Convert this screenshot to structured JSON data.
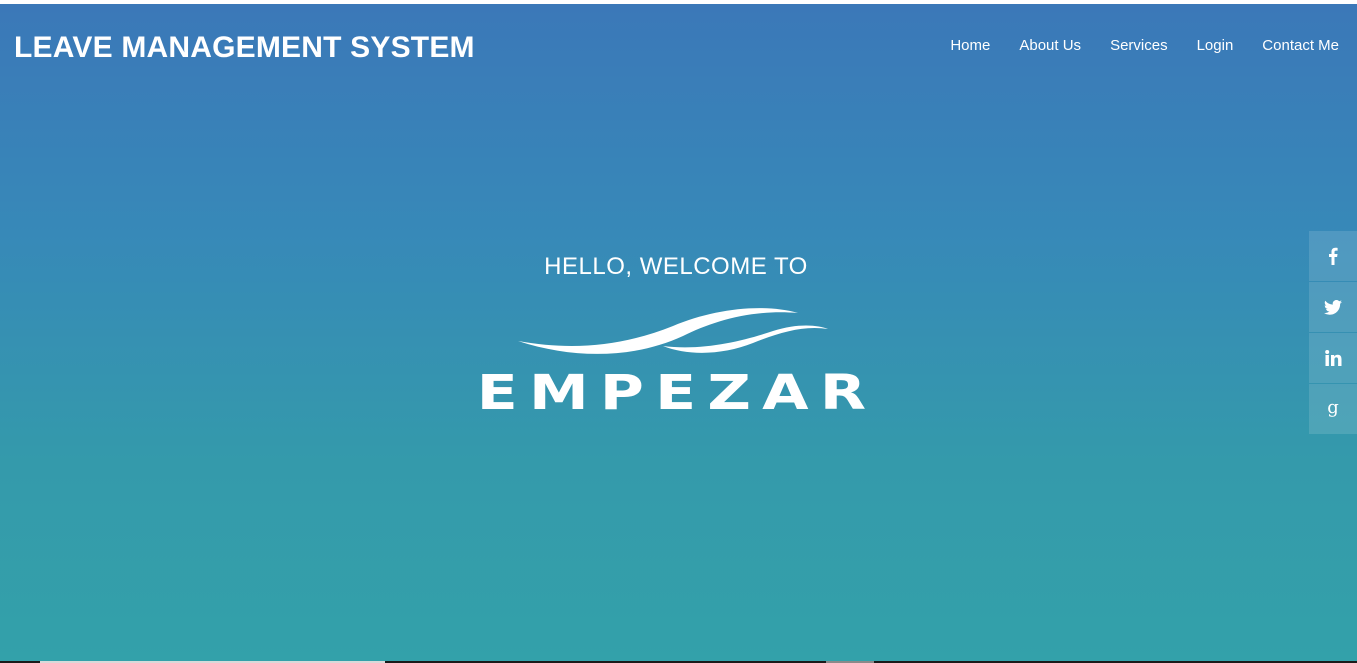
{
  "header": {
    "brand": "LEAVE MANAGEMENT SYSTEM",
    "nav": [
      {
        "label": "Home"
      },
      {
        "label": "About Us"
      },
      {
        "label": "Services"
      },
      {
        "label": "Login"
      },
      {
        "label": "Contact Me"
      }
    ]
  },
  "hero": {
    "greeting": "HELLO, WELCOME TO",
    "logo_text": "EMPEZAR"
  },
  "social": [
    {
      "icon": "facebook-icon"
    },
    {
      "icon": "twitter-icon"
    },
    {
      "icon": "linkedin-icon"
    },
    {
      "icon": "google-icon"
    }
  ],
  "colors": {
    "gradient_top": "#3b78b8",
    "gradient_bottom": "#33a1aa",
    "text": "#ffffff"
  }
}
